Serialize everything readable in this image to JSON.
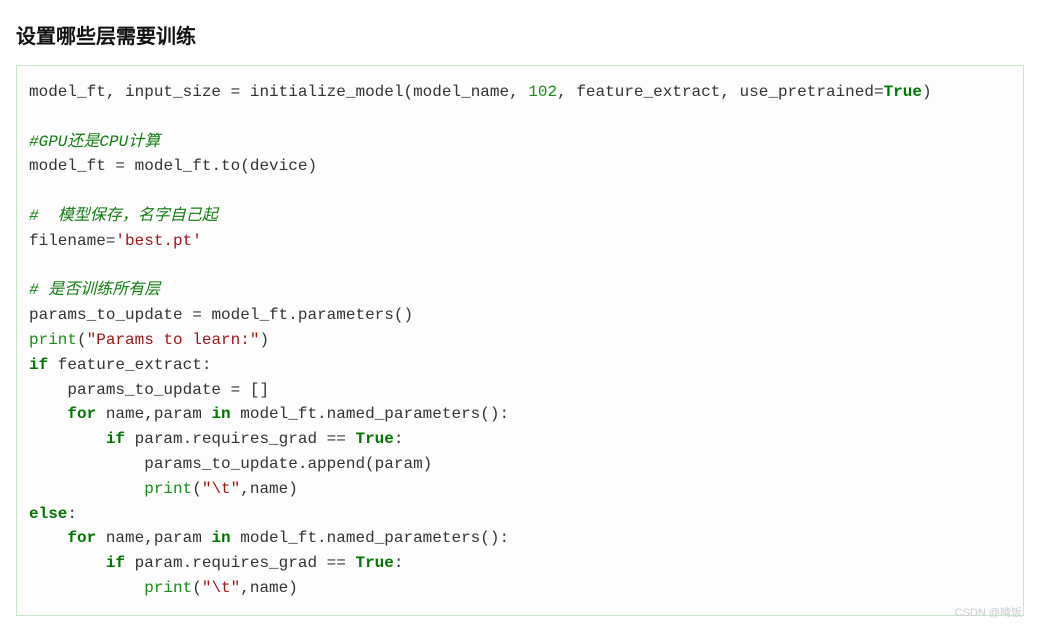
{
  "heading": "设置哪些层需要训练",
  "code": {
    "line1": {
      "t1": "model_ft, input_size ",
      "op1": "=",
      "t2": " initialize_model(model_name, ",
      "num": "102",
      "t3": ", feature_extract, use_pretrained",
      "op2": "=",
      "kw": "True",
      "t4": ")"
    },
    "blank1": "",
    "line2": "#GPU还是CPU计算",
    "line3": {
      "t1": "model_ft ",
      "op": "=",
      "t2": " model_ft.to(device)"
    },
    "blank2": "",
    "line4": "#  模型保存，名字自己起",
    "line5": {
      "t1": "filename",
      "op": "=",
      "str": "'best.pt'"
    },
    "blank3": "",
    "line6": "# 是否训练所有层",
    "line7": {
      "t1": "params_to_update ",
      "op": "=",
      "t2": " model_ft.parameters()"
    },
    "line8": {
      "fn": "print",
      "p1": "(",
      "str": "\"Params to learn:\"",
      "p2": ")"
    },
    "line9": {
      "kw": "if",
      "t": " feature_extract:"
    },
    "line10": {
      "pad": "    ",
      "t1": "params_to_update ",
      "op": "=",
      "t2": " []"
    },
    "line11": {
      "pad": "    ",
      "kw1": "for",
      "t1": " name,param ",
      "kw2": "in",
      "t2": " model_ft.named_parameters():"
    },
    "line12": {
      "pad": "        ",
      "kw": "if",
      "t1": " param.requires_grad ",
      "op": "==",
      "sp": " ",
      "val": "True",
      "t2": ":"
    },
    "line13": {
      "pad": "            ",
      "t": "params_to_update.append(param)"
    },
    "line14": {
      "pad": "            ",
      "fn": "print",
      "p1": "(",
      "str": "\"\\t\"",
      "c": ",name)"
    },
    "line15": {
      "kw": "else",
      "t": ":"
    },
    "line16": {
      "pad": "    ",
      "kw1": "for",
      "t1": " name,param ",
      "kw2": "in",
      "t2": " model_ft.named_parameters():"
    },
    "line17": {
      "pad": "        ",
      "kw": "if",
      "t1": " param.requires_grad ",
      "op": "==",
      "sp": " ",
      "val": "True",
      "t2": ":"
    },
    "line18": {
      "pad": "            ",
      "fn": "print",
      "p1": "(",
      "str": "\"\\t\"",
      "c": ",name)"
    }
  },
  "watermark": "CSDN @啃饭"
}
